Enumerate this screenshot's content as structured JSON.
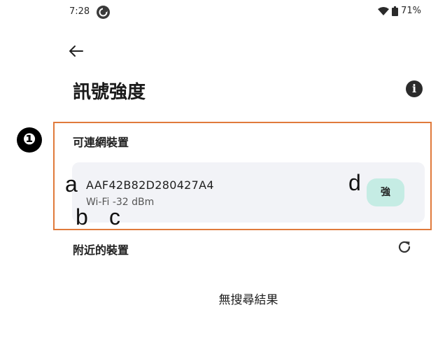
{
  "status_bar": {
    "time": "7:28",
    "battery": "71%"
  },
  "header": {
    "title": "訊號強度"
  },
  "annotation": {
    "marker": "❶",
    "labels": {
      "a": "a",
      "b": "b",
      "c": "c",
      "d": "d"
    }
  },
  "available_section": {
    "title": "可連網裝置",
    "device": {
      "name": "AAF42B82D280427A4",
      "signal": "Wi-Fi -32 dBm",
      "strength_label": "強"
    }
  },
  "nearby_section": {
    "title": "附近的裝置",
    "empty_text": "無搜尋結果"
  },
  "colors": {
    "highlight": "#e07a3b",
    "badge": "#c5ece4",
    "card": "#f2f3f7"
  }
}
